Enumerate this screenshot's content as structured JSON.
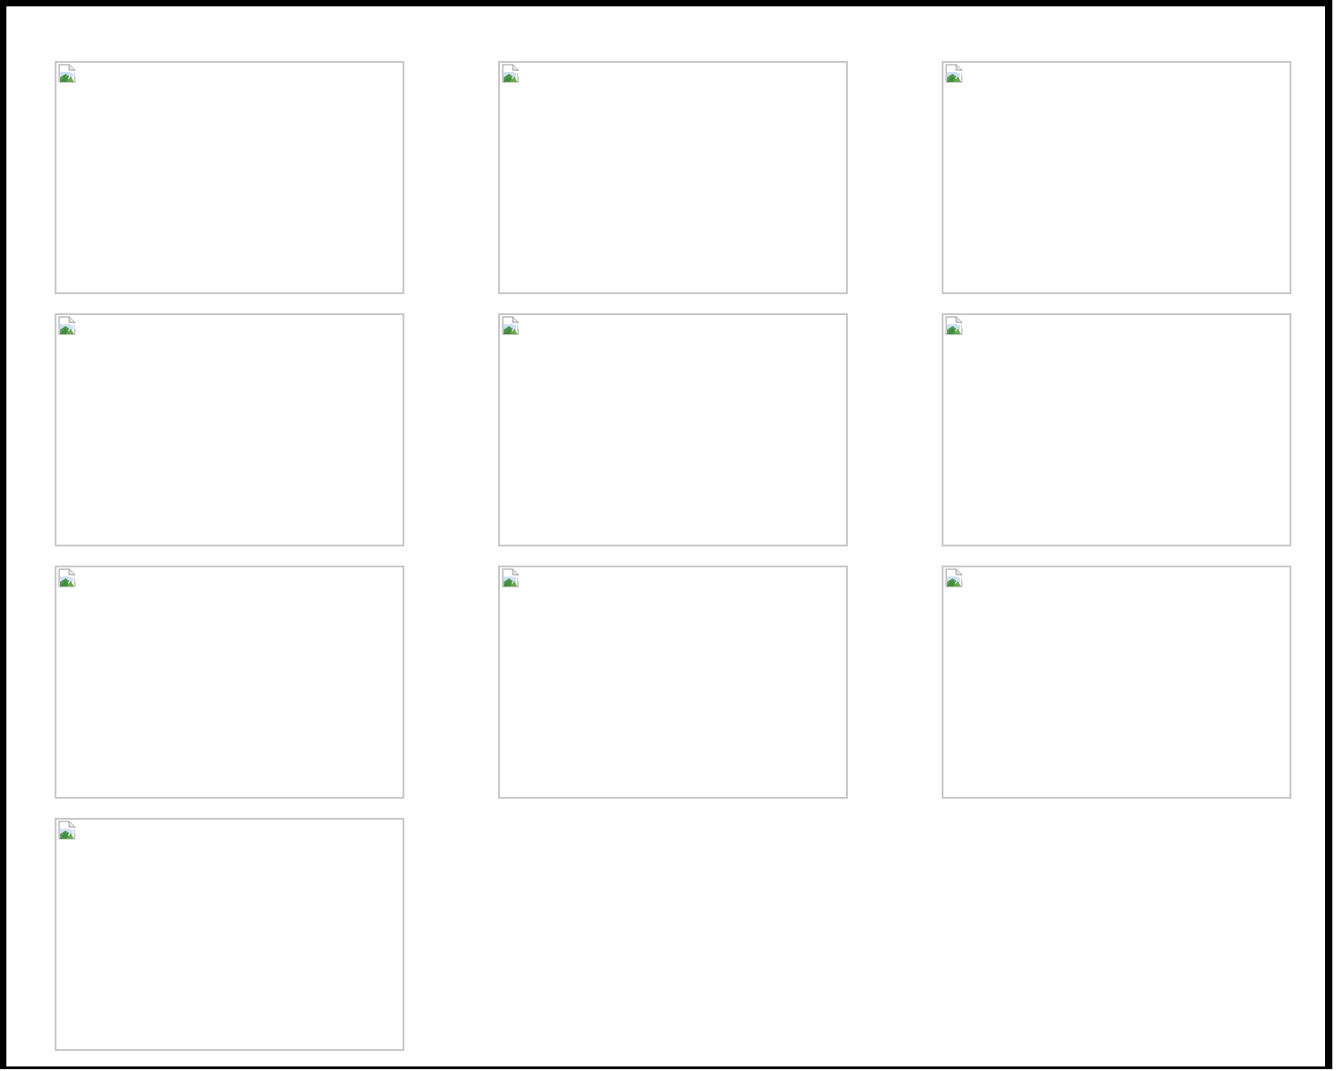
{
  "gallery": {
    "tiles": [
      {
        "icon": "broken-image-icon"
      },
      {
        "icon": "broken-image-icon"
      },
      {
        "icon": "broken-image-icon"
      },
      {
        "icon": "broken-image-icon"
      },
      {
        "icon": "broken-image-icon"
      },
      {
        "icon": "broken-image-icon"
      },
      {
        "icon": "broken-image-icon"
      },
      {
        "icon": "broken-image-icon"
      },
      {
        "icon": "broken-image-icon"
      },
      {
        "icon": "broken-image-icon"
      }
    ]
  },
  "colors": {
    "frame_border": "#000000",
    "tile_border": "#c8c8c8",
    "background": "#ffffff"
  }
}
